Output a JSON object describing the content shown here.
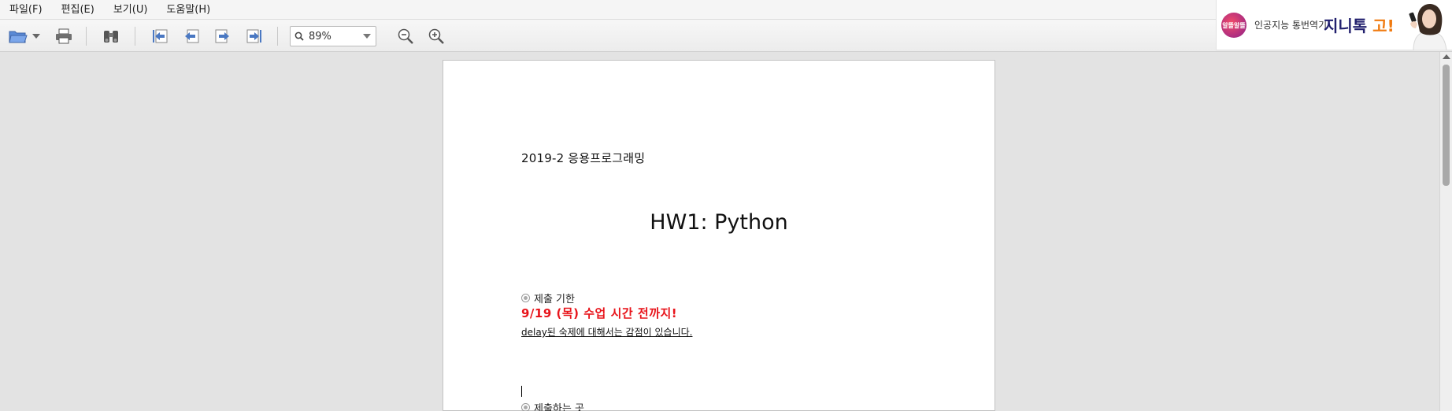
{
  "menu": {
    "items": [
      "파일(F)",
      "편집(E)",
      "보기(U)",
      "도움말(H)"
    ]
  },
  "toolbar": {
    "zoom_value": "89%",
    "icons": [
      "open-folder-icon",
      "dropdown-arrow-icon",
      "print-icon",
      "find-binoculars-icon",
      "first-page-icon",
      "previous-page-icon",
      "next-page-icon",
      "last-page-icon",
      "search-icon",
      "zoom-out-icon",
      "zoom-in-icon"
    ]
  },
  "ad": {
    "badge": "알뜰알뜰",
    "subtitle": "인공지능 통번역기",
    "brand": "지니톡",
    "brand_suffix": "고!"
  },
  "document": {
    "header": "2019-2 응용프로그래밍",
    "title": "HW1: Python",
    "section1_label": "제출 기한",
    "deadline": "9/19 (목) 수업 시간 전까지!",
    "late_note": "delay된 숙제에 대해서는 감점이 있습니다.",
    "section2_label": "제출하는 곳"
  },
  "colors": {
    "accent_red": "#e8141b",
    "brand_navy": "#22206e",
    "brand_orange": "#f07a10",
    "icon_blue": "#4a78c2"
  }
}
